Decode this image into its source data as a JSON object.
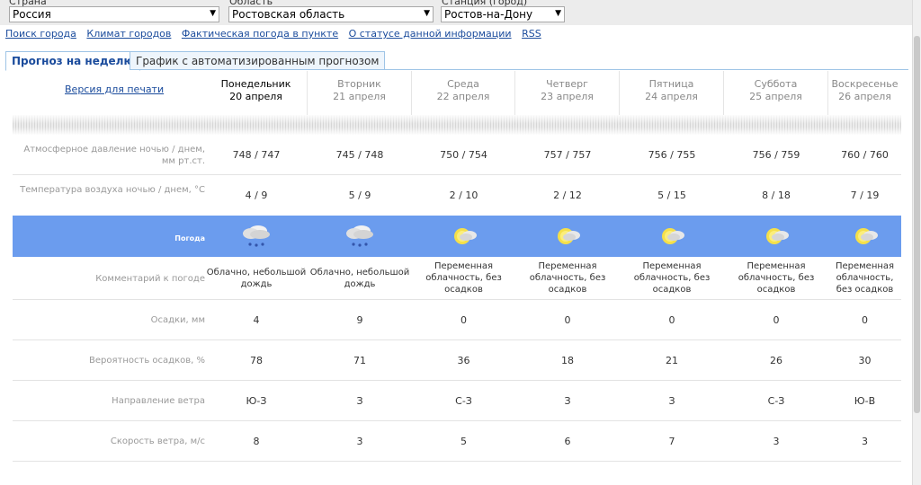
{
  "selectors": {
    "country": {
      "label": "Страна",
      "value": "Россия"
    },
    "region": {
      "label": "Область",
      "value": "Ростовская область"
    },
    "station": {
      "label": "Станция (город)",
      "value": "Ростов-на-Дону"
    }
  },
  "links": [
    "Поиск города",
    "Климат городов",
    "Фактическая погода в пункте",
    "О статусе данной информации",
    "RSS"
  ],
  "tabs": {
    "active": "Прогноз на неделю",
    "inactive": "График с автоматизированным прогнозом"
  },
  "print_link": "Версия для печати",
  "days": [
    {
      "name": "Понедельник",
      "date": "20 апреля"
    },
    {
      "name": "Вторник",
      "date": "21 апреля"
    },
    {
      "name": "Среда",
      "date": "22 апреля"
    },
    {
      "name": "Четверг",
      "date": "23 апреля"
    },
    {
      "name": "Пятница",
      "date": "24 апреля"
    },
    {
      "name": "Суббота",
      "date": "25 апреля"
    },
    {
      "name": "Воскресенье",
      "date": "26 апреля"
    }
  ],
  "rows": {
    "pressure": {
      "label": "Атмосферное давление ночью / днем, мм рт.ст.",
      "values": [
        "748 / 747",
        "745 / 748",
        "750 / 754",
        "757 / 757",
        "756 / 755",
        "756 / 759",
        "760 / 760"
      ]
    },
    "temperature": {
      "label": "Температура воздуха ночью / днем, °C",
      "values": [
        "4 / 9",
        "5 / 9",
        "2 / 10",
        "2 / 12",
        "5 / 15",
        "8 / 18",
        "7 / 19"
      ]
    },
    "weather": {
      "label": "Погода",
      "icons": [
        "rain-cloud-icon",
        "rain-cloud-icon",
        "partly-cloudy-icon",
        "partly-cloudy-icon",
        "partly-cloudy-icon",
        "partly-cloudy-icon",
        "partly-cloudy-icon"
      ]
    },
    "comment": {
      "label": "Комментарий к погоде",
      "values": [
        "Облачно, небольшой дождь",
        "Облачно, небольшой дождь",
        "Переменная облачность, без осадков",
        "Переменная облачность, без осадков",
        "Переменная облачность, без осадков",
        "Переменная облачность, без осадков",
        "Переменная облачность, без осадков"
      ]
    },
    "precip": {
      "label": "Осадки, мм",
      "values": [
        "4",
        "9",
        "0",
        "0",
        "0",
        "0",
        "0"
      ]
    },
    "probability": {
      "label": "Вероятность осадков, %",
      "values": [
        "78",
        "71",
        "36",
        "18",
        "21",
        "26",
        "30"
      ]
    },
    "wind_dir": {
      "label": "Направление ветра",
      "values": [
        "Ю-З",
        "З",
        "С-З",
        "З",
        "З",
        "С-З",
        "Ю-В"
      ]
    },
    "wind_speed": {
      "label": "Скорость ветра, м/с",
      "values": [
        "8",
        "3",
        "5",
        "6",
        "7",
        "3",
        "3"
      ]
    }
  },
  "colors": {
    "weather_row_bg": "#6b9cee",
    "link": "#1a4b9c"
  }
}
